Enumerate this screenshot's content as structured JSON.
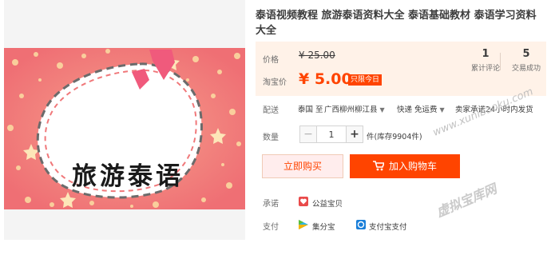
{
  "product": {
    "title": "泰语视频教程 旅游泰语资料大全 泰语基础教材 泰语学习资料大全",
    "image_text": "旅游泰语"
  },
  "price": {
    "label": "价格",
    "original": "¥ 25.00",
    "promo_label": "淘宝价",
    "promo": "¥ 5.00",
    "promo_tag": "只限今日"
  },
  "stats": {
    "reviews_count": "1",
    "reviews_label": "累计评论",
    "sales_count": "5",
    "sales_label": "交易成功"
  },
  "shipping": {
    "label": "配送",
    "origin": "泰国 至",
    "destination": "广西柳州柳江县",
    "delivery": "快递 免运费",
    "promise": "卖家承诺24小时内发货"
  },
  "quantity": {
    "label": "数量",
    "value": "1",
    "minus": "−",
    "plus": "+",
    "stock": "件(库存9904件)"
  },
  "actions": {
    "buy_now": "立即购买",
    "add_to_cart": "加入购物车"
  },
  "services": {
    "promise_label": "承诺",
    "promise_item": "公益宝贝",
    "payment_label": "支付",
    "payment_item1": "集分宝",
    "payment_item2": "支付宝支付"
  },
  "watermarks": {
    "url": "www.xunibaoku.com",
    "site": "虚拟宝库网"
  },
  "colors": {
    "accent": "#ff4400",
    "price_bg": "#fff2e8",
    "banner_bg": "#f0787a"
  }
}
